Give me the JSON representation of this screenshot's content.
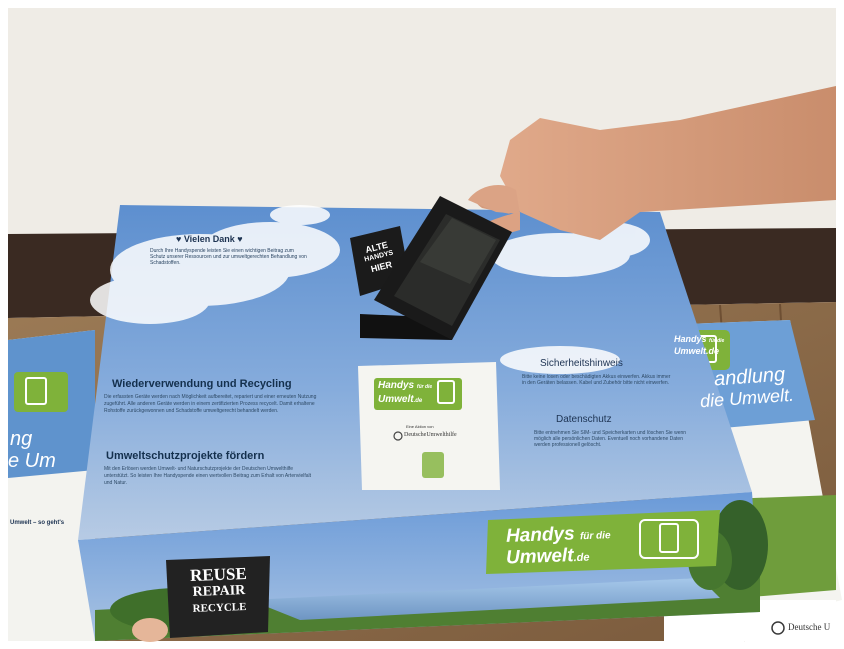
{
  "box_top": {
    "thanks_title": "♥ Vielen Dank ♥",
    "thanks_text": "Durch Ihre Handyspende leisten Sie einen wichtigen Beitrag zum Schutz unserer Ressourcen und zur umweltgerechten Behandlung von Schadstoffen.",
    "reuse_title": "Wiederverwendung und Recycling",
    "reuse_text": "Die erfassten Geräte werden nach Möglichkeit aufbereitet, repariert und einer erneuten Nutzung zugeführt. Alle anderen Geräte werden in einem zertifizierten Prozess recycelt. Damit erhaltene Rohstoffe zurückgewonnen und Schadstoffe umweltgerecht behandelt werden.",
    "projects_title": "Umweltschutzprojekte fördern",
    "projects_text": "Mit den Erlösen werden Umwelt- und Naturschutzprojekte der Deutschen Umwelthilfe unterstützt. So leisten Ihre Handyspende einen wertvollen Beitrag zum Erhalt von Artenvielfalt und Natur.",
    "security_title": "Sicherheitshinweis",
    "security_text": "Bitte keine losen oder beschädigten Akkus einwerfen. Akkus immer in den Geräten belassen. Kabel und Zubehör bitte nicht einwerfen.",
    "privacy_title": "Datenschutz",
    "privacy_text": "Bitte entnehmen Sie SIM- und Speicherkarten und löschen Sie wenn möglich alle persönlichen Daten. Eventuell noch vorhandene Daten werden professionell gelöscht.",
    "sticker_lines": [
      "ALTE",
      "HANDYS",
      "HIER"
    ]
  },
  "logo_card": {
    "line1": "Handys",
    "line1_small": "für die",
    "line2": "Umwelt",
    "line2_suffix": ".de",
    "supported_by": "Eine Aktion von",
    "org_name": "DeutscheUmwelthilfe"
  },
  "box_front": {
    "brand_line1": "Handys",
    "brand_small": "für die",
    "brand_line2": "Umwelt",
    "brand_suffix": ".de",
    "sign_lines": [
      "REUSE",
      "REPAIR",
      "RECYCLE"
    ]
  },
  "right_poster": {
    "headline1": "andlung",
    "headline2": "die Umwelt.",
    "brand_line1": "Handys",
    "brand_small": "für die",
    "brand_line2": "Umwelt.de",
    "footer_org": "Deutsche U"
  },
  "left_poster": {
    "headline1": "ng",
    "headline2": "e Um",
    "subhead": "Umwelt – so geht's"
  },
  "colors": {
    "wall": "#efece6",
    "baseboard": "#3a2a22",
    "floor": "#8a6a48",
    "sky": "#6f9fd6",
    "brand_green": "#7fb23a",
    "panel_white": "#f5f5f1",
    "phone": "#1a1a1a"
  }
}
